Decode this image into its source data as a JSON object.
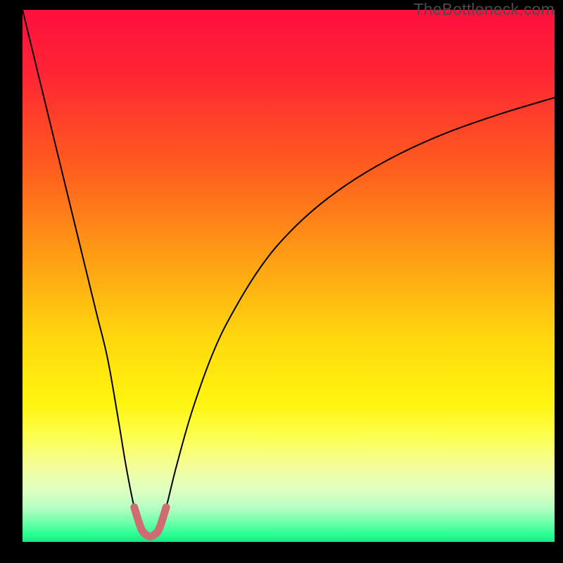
{
  "watermark": "TheBottleneck.com",
  "chart_data": {
    "type": "line",
    "title": "",
    "xlabel": "",
    "ylabel": "",
    "xlim": [
      0,
      100
    ],
    "ylim": [
      0,
      100
    ],
    "background_gradient_stops": [
      {
        "pos": 0.0,
        "color": "#ff0f3f"
      },
      {
        "pos": 0.12,
        "color": "#ff2534"
      },
      {
        "pos": 0.3,
        "color": "#ff5e1e"
      },
      {
        "pos": 0.48,
        "color": "#ffa313"
      },
      {
        "pos": 0.62,
        "color": "#ffd90e"
      },
      {
        "pos": 0.74,
        "color": "#fff50f"
      },
      {
        "pos": 0.8,
        "color": "#fdff4d"
      },
      {
        "pos": 0.86,
        "color": "#f4ff9d"
      },
      {
        "pos": 0.9,
        "color": "#e1ffc0"
      },
      {
        "pos": 0.935,
        "color": "#b8ffc4"
      },
      {
        "pos": 0.962,
        "color": "#72ffab"
      },
      {
        "pos": 0.985,
        "color": "#2cff95"
      },
      {
        "pos": 1.0,
        "color": "#15ea80"
      }
    ],
    "series": [
      {
        "name": "bottleneck-curve",
        "color": "#000000",
        "stroke_width": 2,
        "x": [
          0.0,
          2.0,
          4.0,
          6.0,
          8.0,
          10.0,
          12.0,
          14.0,
          16.0,
          18.0,
          19.5,
          21.0,
          22.3,
          23.3,
          24.0,
          24.7,
          25.7,
          27.0,
          29.0,
          32.0,
          36.0,
          40.0,
          45.0,
          50.0,
          56.0,
          63.0,
          71.0,
          80.0,
          90.0,
          100.0
        ],
        "values": [
          100.0,
          91.8,
          83.6,
          75.4,
          67.2,
          59.0,
          50.8,
          42.6,
          34.4,
          23.0,
          14.0,
          6.5,
          2.5,
          1.3,
          1.0,
          1.3,
          2.5,
          6.5,
          14.5,
          25.0,
          36.0,
          44.0,
          52.0,
          58.0,
          63.5,
          68.5,
          73.0,
          77.0,
          80.5,
          83.5
        ]
      },
      {
        "name": "highlight-bottom",
        "color": "#ce6b73",
        "stroke_width": 11,
        "x": [
          21.0,
          22.3,
          23.3,
          24.0,
          24.7,
          25.7,
          27.0
        ],
        "values": [
          6.5,
          2.5,
          1.3,
          1.0,
          1.3,
          2.5,
          6.5
        ]
      }
    ],
    "minimum_point": {
      "x": 24.0,
      "y": 1.0
    }
  }
}
